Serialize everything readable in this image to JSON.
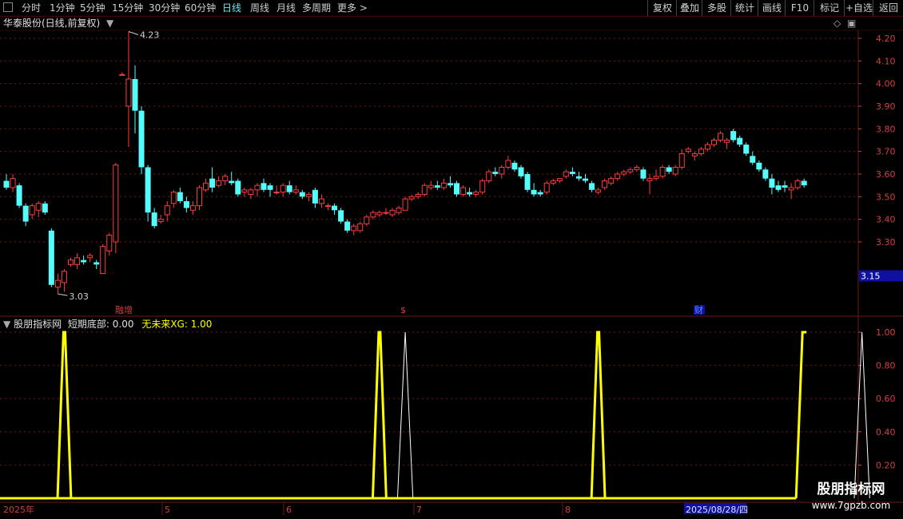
{
  "toolbar": {
    "periods": [
      "分时",
      "1分钟",
      "5分钟",
      "15分钟",
      "30分钟",
      "60分钟",
      "日线",
      "周线",
      "月线",
      "多周期",
      "更多 >"
    ],
    "active_period": "日线",
    "right_buttons": [
      "复权",
      "叠加",
      "多股",
      "统计",
      "画线",
      "F10",
      "标记",
      "+自选",
      "返回"
    ]
  },
  "main_chart": {
    "title": "华泰股份(日线,前复权)",
    "max_label": "4.23",
    "min_label": "3.03",
    "current_price": "3.15",
    "event_markers": [
      "融增",
      "$",
      "财"
    ]
  },
  "indicator": {
    "name": "股朋指标网",
    "formula_label": "短期底部: 0.00",
    "xg_label": "无未来XG: 1.00"
  },
  "timeline": {
    "labels": [
      "2025年",
      "5",
      "6",
      "7",
      "8",
      "2025/08/28/四"
    ]
  },
  "watermark": {
    "line1": "股朋指标网",
    "line2": "www.7gpzb.com"
  },
  "colors": {
    "up": "#ff3c3c",
    "down": "#54fcfc",
    "signal": "#ffff00",
    "xg": "#ffffff",
    "axis": "#d04040",
    "grid": "#6a1a1a"
  },
  "chart_data": [
    {
      "type": "candlestick",
      "title": "华泰股份(日线,前复权)",
      "y_ticks": [
        4.2,
        4.1,
        4.0,
        3.9,
        3.8,
        3.7,
        3.6,
        3.5,
        3.4,
        3.3
      ],
      "ylim": [
        3.0,
        4.3
      ],
      "ohlc": [
        [
          3.57,
          3.6,
          3.53,
          3.54
        ],
        [
          3.54,
          3.6,
          3.52,
          3.58
        ],
        [
          3.55,
          3.56,
          3.45,
          3.46
        ],
        [
          3.46,
          3.47,
          3.37,
          3.39
        ],
        [
          3.42,
          3.47,
          3.4,
          3.46
        ],
        [
          3.44,
          3.48,
          3.41,
          3.47
        ],
        [
          3.47,
          3.48,
          3.42,
          3.43
        ],
        [
          3.35,
          3.36,
          3.1,
          3.11
        ],
        [
          3.1,
          3.16,
          3.07,
          3.13
        ],
        [
          3.12,
          3.18,
          3.08,
          3.17
        ],
        [
          3.2,
          3.23,
          3.19,
          3.22
        ],
        [
          3.2,
          3.25,
          3.18,
          3.23
        ],
        [
          3.22,
          3.24,
          3.2,
          3.21
        ],
        [
          3.23,
          3.25,
          3.21,
          3.24
        ],
        [
          3.21,
          3.22,
          3.18,
          3.2
        ],
        [
          3.16,
          3.29,
          3.16,
          3.28
        ],
        [
          3.26,
          3.34,
          3.24,
          3.33
        ],
        [
          3.3,
          3.65,
          3.25,
          3.64
        ],
        [
          4.04,
          4.05,
          4.04,
          4.04
        ],
        [
          3.9,
          4.23,
          3.72,
          4.02
        ],
        [
          4.02,
          4.08,
          3.78,
          3.88
        ],
        [
          3.88,
          3.9,
          3.6,
          3.63
        ],
        [
          3.63,
          3.64,
          3.39,
          3.43
        ],
        [
          3.43,
          3.45,
          3.36,
          3.37
        ],
        [
          3.39,
          3.42,
          3.38,
          3.4
        ],
        [
          3.42,
          3.48,
          3.39,
          3.46
        ],
        [
          3.47,
          3.53,
          3.45,
          3.52
        ],
        [
          3.52,
          3.54,
          3.47,
          3.48
        ],
        [
          3.48,
          3.5,
          3.43,
          3.45
        ],
        [
          3.44,
          3.48,
          3.42,
          3.46
        ],
        [
          3.46,
          3.55,
          3.44,
          3.54
        ],
        [
          3.53,
          3.58,
          3.52,
          3.56
        ],
        [
          3.58,
          3.63,
          3.52,
          3.54
        ],
        [
          3.55,
          3.59,
          3.54,
          3.57
        ],
        [
          3.57,
          3.6,
          3.55,
          3.59
        ],
        [
          3.57,
          3.61,
          3.55,
          3.56
        ],
        [
          3.57,
          3.58,
          3.5,
          3.51
        ],
        [
          3.52,
          3.54,
          3.5,
          3.53
        ],
        [
          3.51,
          3.54,
          3.49,
          3.53
        ],
        [
          3.53,
          3.56,
          3.5,
          3.55
        ],
        [
          3.56,
          3.58,
          3.52,
          3.53
        ],
        [
          3.55,
          3.56,
          3.5,
          3.53
        ],
        [
          3.52,
          3.55,
          3.51,
          3.52
        ],
        [
          3.52,
          3.56,
          3.5,
          3.55
        ],
        [
          3.55,
          3.57,
          3.51,
          3.52
        ],
        [
          3.52,
          3.55,
          3.51,
          3.53
        ],
        [
          3.52,
          3.53,
          3.49,
          3.5
        ],
        [
          3.5,
          3.52,
          3.48,
          3.51
        ],
        [
          3.53,
          3.54,
          3.45,
          3.47
        ],
        [
          3.47,
          3.51,
          3.45,
          3.49
        ],
        [
          3.46,
          3.47,
          3.44,
          3.46
        ],
        [
          3.46,
          3.47,
          3.42,
          3.44
        ],
        [
          3.44,
          3.45,
          3.38,
          3.39
        ],
        [
          3.39,
          3.4,
          3.34,
          3.35
        ],
        [
          3.35,
          3.38,
          3.33,
          3.37
        ],
        [
          3.35,
          3.39,
          3.34,
          3.38
        ],
        [
          3.38,
          3.42,
          3.37,
          3.41
        ],
        [
          3.41,
          3.44,
          3.4,
          3.43
        ],
        [
          3.42,
          3.44,
          3.41,
          3.43
        ],
        [
          3.43,
          3.45,
          3.42,
          3.43
        ],
        [
          3.42,
          3.45,
          3.41,
          3.44
        ],
        [
          3.43,
          3.46,
          3.42,
          3.45
        ],
        [
          3.44,
          3.5,
          3.44,
          3.49
        ],
        [
          3.49,
          3.51,
          3.48,
          3.5
        ],
        [
          3.5,
          3.52,
          3.49,
          3.51
        ],
        [
          3.51,
          3.56,
          3.5,
          3.55
        ],
        [
          3.54,
          3.57,
          3.53,
          3.55
        ],
        [
          3.55,
          3.57,
          3.53,
          3.54
        ],
        [
          3.54,
          3.58,
          3.53,
          3.56
        ],
        [
          3.56,
          3.59,
          3.54,
          3.55
        ],
        [
          3.56,
          3.57,
          3.5,
          3.51
        ],
        [
          3.51,
          3.55,
          3.5,
          3.54
        ],
        [
          3.52,
          3.54,
          3.5,
          3.51
        ],
        [
          3.51,
          3.53,
          3.5,
          3.52
        ],
        [
          3.52,
          3.58,
          3.51,
          3.57
        ],
        [
          3.57,
          3.62,
          3.56,
          3.61
        ],
        [
          3.61,
          3.63,
          3.59,
          3.6
        ],
        [
          3.6,
          3.64,
          3.58,
          3.63
        ],
        [
          3.63,
          3.68,
          3.62,
          3.66
        ],
        [
          3.65,
          3.66,
          3.61,
          3.62
        ],
        [
          3.63,
          3.64,
          3.58,
          3.59
        ],
        [
          3.6,
          3.61,
          3.52,
          3.53
        ],
        [
          3.53,
          3.56,
          3.5,
          3.51
        ],
        [
          3.52,
          3.53,
          3.5,
          3.51
        ],
        [
          3.52,
          3.57,
          3.51,
          3.56
        ],
        [
          3.56,
          3.58,
          3.55,
          3.57
        ],
        [
          3.57,
          3.58,
          3.56,
          3.58
        ],
        [
          3.59,
          3.62,
          3.58,
          3.61
        ],
        [
          3.61,
          3.63,
          3.59,
          3.6
        ],
        [
          3.59,
          3.61,
          3.57,
          3.58
        ],
        [
          3.58,
          3.6,
          3.56,
          3.57
        ],
        [
          3.56,
          3.57,
          3.52,
          3.53
        ],
        [
          3.52,
          3.54,
          3.51,
          3.53
        ],
        [
          3.54,
          3.58,
          3.53,
          3.57
        ],
        [
          3.56,
          3.59,
          3.55,
          3.58
        ],
        [
          3.58,
          3.61,
          3.57,
          3.6
        ],
        [
          3.6,
          3.62,
          3.59,
          3.61
        ],
        [
          3.61,
          3.63,
          3.6,
          3.62
        ],
        [
          3.62,
          3.64,
          3.61,
          3.63
        ],
        [
          3.62,
          3.63,
          3.57,
          3.58
        ],
        [
          3.57,
          3.6,
          3.51,
          3.58
        ],
        [
          3.58,
          3.62,
          3.57,
          3.59
        ],
        [
          3.59,
          3.64,
          3.58,
          3.63
        ],
        [
          3.63,
          3.64,
          3.6,
          3.61
        ],
        [
          3.6,
          3.64,
          3.59,
          3.63
        ],
        [
          3.63,
          3.71,
          3.62,
          3.69
        ],
        [
          3.7,
          3.72,
          3.69,
          3.71
        ],
        [
          3.68,
          3.7,
          3.66,
          3.69
        ],
        [
          3.69,
          3.72,
          3.68,
          3.71
        ],
        [
          3.71,
          3.74,
          3.7,
          3.73
        ],
        [
          3.73,
          3.76,
          3.72,
          3.75
        ],
        [
          3.75,
          3.79,
          3.74,
          3.78
        ],
        [
          3.74,
          3.76,
          3.71,
          3.75
        ],
        [
          3.79,
          3.8,
          3.74,
          3.75
        ],
        [
          3.76,
          3.77,
          3.72,
          3.73
        ],
        [
          3.73,
          3.74,
          3.68,
          3.69
        ],
        [
          3.68,
          3.7,
          3.64,
          3.65
        ],
        [
          3.65,
          3.66,
          3.61,
          3.62
        ],
        [
          3.62,
          3.63,
          3.57,
          3.58
        ],
        [
          3.58,
          3.6,
          3.51,
          3.54
        ],
        [
          3.55,
          3.57,
          3.52,
          3.53
        ],
        [
          3.55,
          3.57,
          3.52,
          3.54
        ],
        [
          3.53,
          3.56,
          3.49,
          3.54
        ],
        [
          3.54,
          3.58,
          3.53,
          3.57
        ],
        [
          3.57,
          3.58,
          3.54,
          3.55
        ]
      ]
    },
    {
      "type": "line",
      "title": "股朋指标网",
      "y_ticks": [
        1.0,
        0.8,
        0.6,
        0.4,
        0.2
      ],
      "ylim": [
        0,
        1.02
      ],
      "series": [
        {
          "name": "短期底部",
          "spikes": [
            9,
            58,
            92
          ],
          "value_at_end": 1
        },
        {
          "name": "无未来XG",
          "spikes": [
            62,
            133
          ],
          "value_at_end": 1
        }
      ]
    }
  ]
}
